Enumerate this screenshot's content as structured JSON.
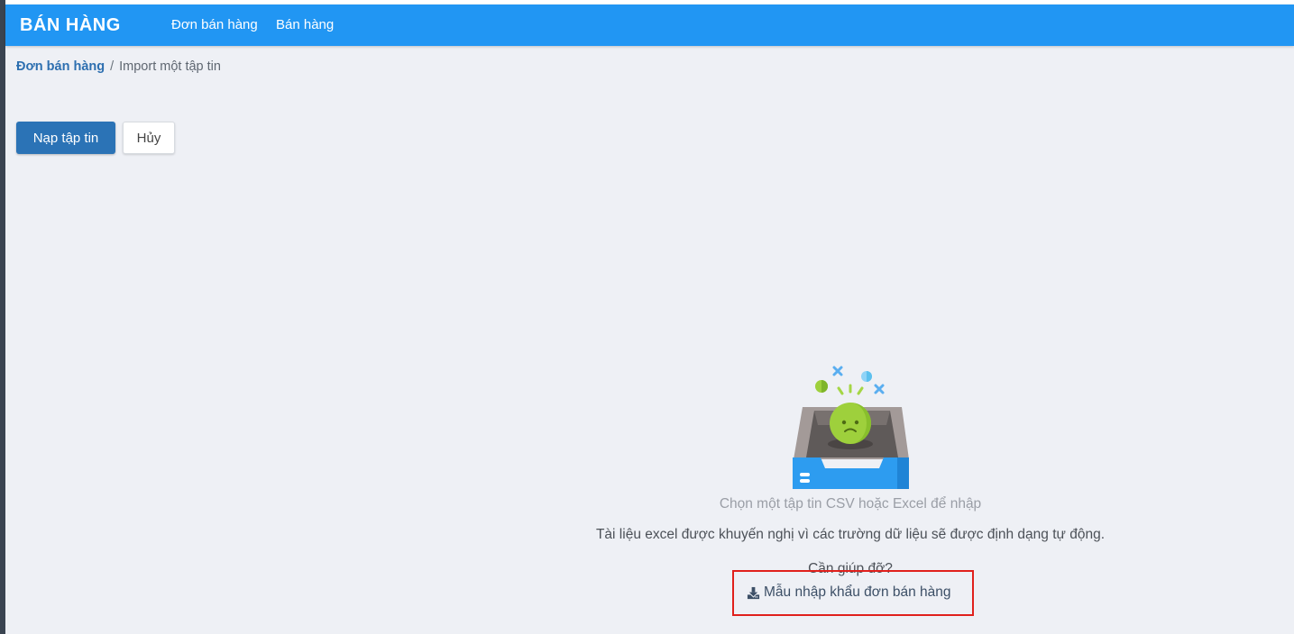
{
  "app": {
    "brand": "BÁN HÀNG",
    "nav": [
      {
        "label": "Đơn bán hàng"
      },
      {
        "label": "Bán hàng"
      }
    ]
  },
  "breadcrumb": {
    "parent": "Đơn bán hàng",
    "separator": "/",
    "current": "Import một tập tin"
  },
  "actions": {
    "upload_label": "Nạp tập tin",
    "cancel_label": "Hủy"
  },
  "empty_state": {
    "icon": "sad-empty-inbox-illustration",
    "prompt": "Chọn một tập tin CSV hoặc Excel để nhập",
    "recommendation": "Tài liệu excel được khuyến nghị vì các trường dữ liệu sẽ được định dạng tự động.",
    "help_text": "Cần giúp đỡ?",
    "template_link_icon": "download-icon",
    "template_link_label": "Mẫu nhập khẩu đơn bán hàng"
  },
  "colors": {
    "navbar": "#2196f3",
    "primary_button": "#2b73b6",
    "link": "#2d6fb0",
    "highlight": "#e0201c",
    "background": "#eef0f5"
  }
}
